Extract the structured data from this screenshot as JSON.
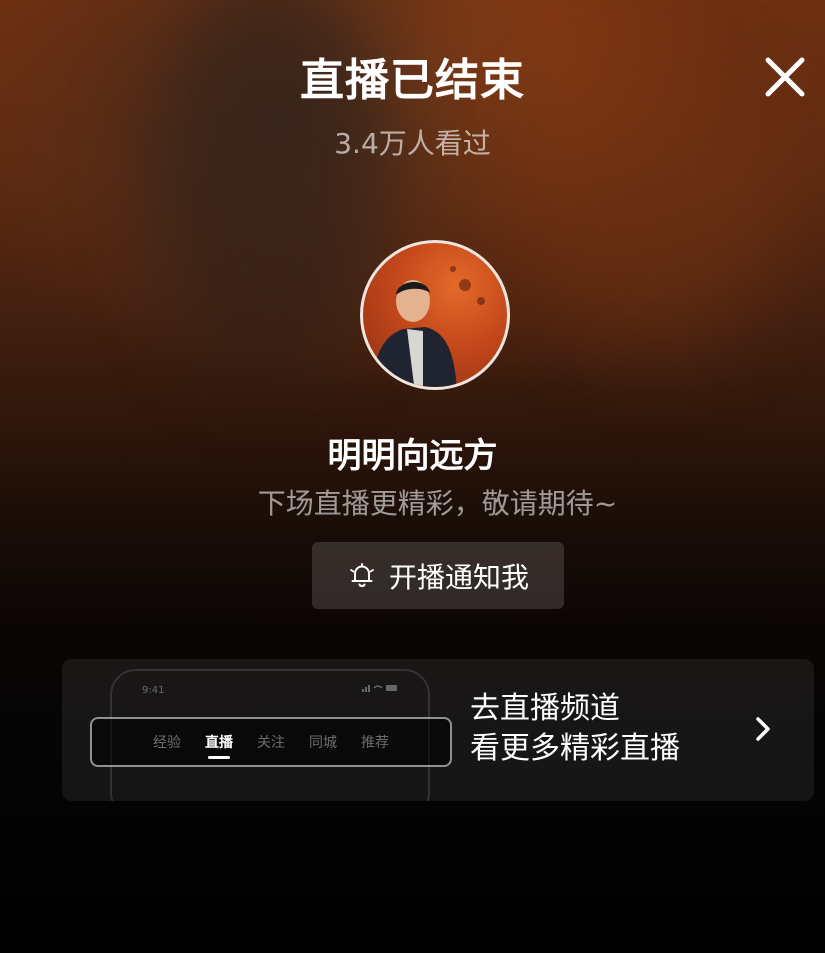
{
  "header": {
    "title": "直播已结束",
    "viewers": "3.4万人看过",
    "close_icon": "close-icon"
  },
  "streamer": {
    "name": "明明向远方",
    "message": "下场直播更精彩，敬请期待~"
  },
  "notify_button": {
    "label": "开播通知我",
    "icon": "bell-icon"
  },
  "channel_card": {
    "line1": "去直播频道",
    "line2": "看更多精彩直播",
    "icon": "chevron-right-icon",
    "preview": {
      "time": "9:41",
      "tabs": [
        "经验",
        "直播",
        "关注",
        "同城",
        "推荐"
      ],
      "active_tab": "直播"
    }
  },
  "colors": {
    "background_top": "#6e3114",
    "background_bottom": "#000000",
    "text_primary": "#ffffff"
  }
}
